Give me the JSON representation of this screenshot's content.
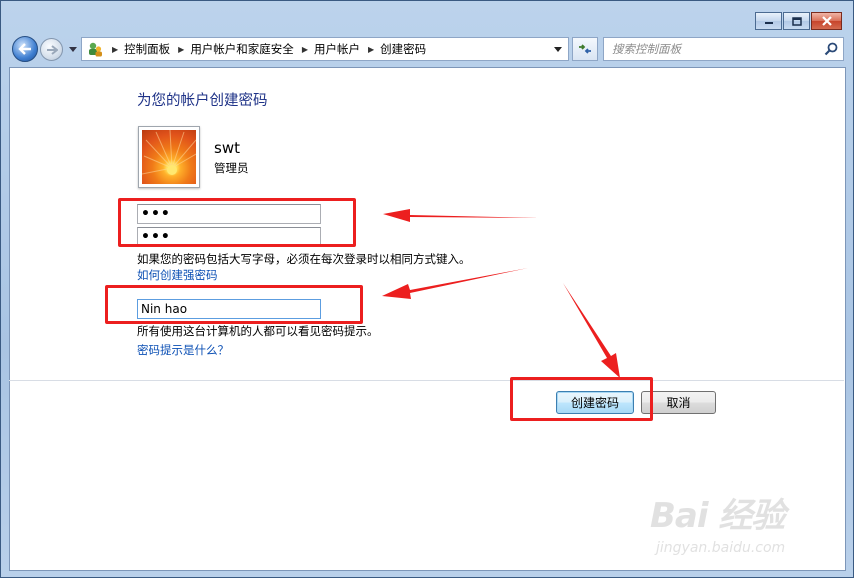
{
  "window": {
    "caption_buttons": [
      "minimize-icon",
      "maximize-icon",
      "close-icon"
    ]
  },
  "nav": {
    "breadcrumbs": [
      "控制面板",
      "用户帐户和家庭安全",
      "用户帐户",
      "创建密码"
    ],
    "search_placeholder": "搜索控制面板"
  },
  "content": {
    "heading": "为您的帐户创建密码",
    "user": {
      "name": "swt",
      "role": "管理员"
    },
    "new_password": "•••",
    "confirm_password": "•••",
    "case_note": "如果您的密码包括大写字母，必须在每次登录时以相同方式键入。",
    "strong_password_link": "如何创建强密码",
    "hint_value": "Nin hao",
    "hint_note": "所有使用这台计算机的人都可以看见密码提示。",
    "hint_link": "密码提示是什么？"
  },
  "buttons": {
    "create": "创建密码",
    "cancel": "取消"
  },
  "watermark": {
    "logo": "Bai 经验",
    "site": "jingyan.baidu.com"
  },
  "colors": {
    "heading": "#1e3287",
    "link": "#0b4fb4",
    "annotation": "#ec1f1f"
  }
}
